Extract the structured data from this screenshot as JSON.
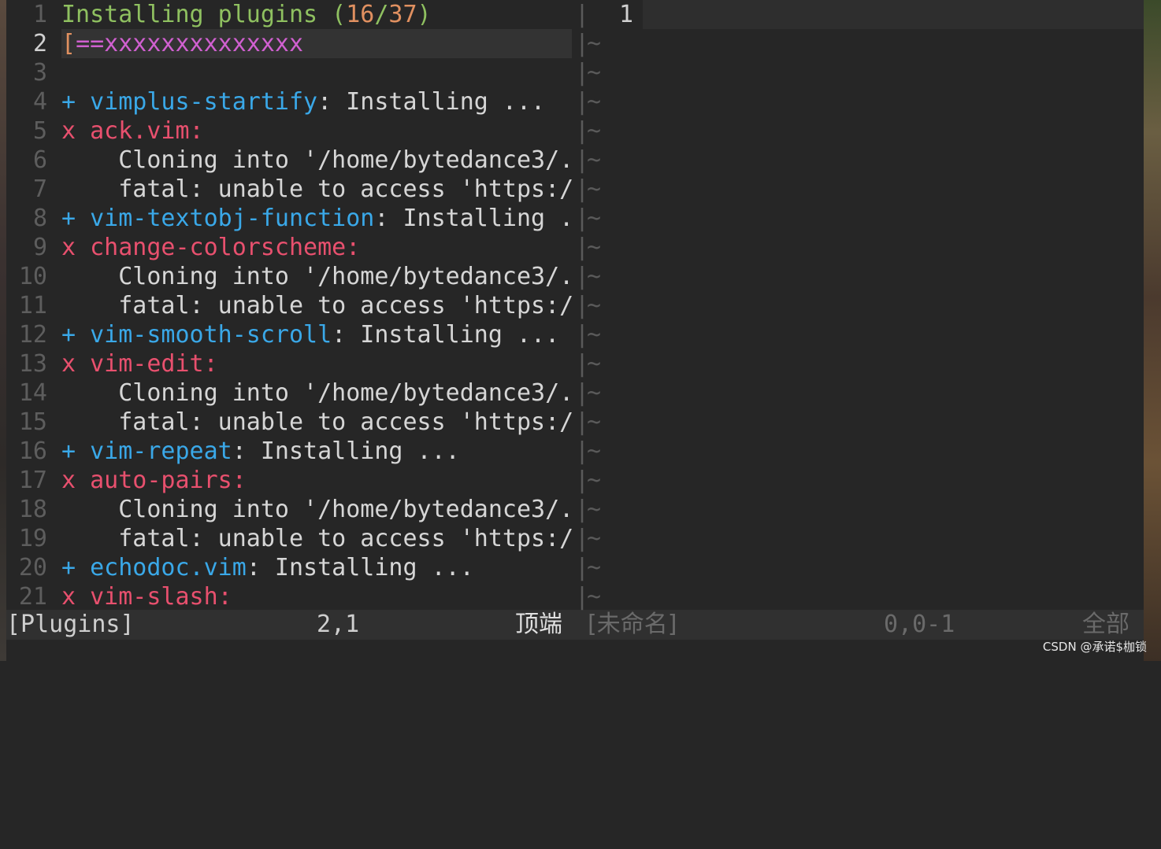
{
  "left_pane": {
    "lines": [
      {
        "num": "1",
        "segments": [
          {
            "text": "Installing plugins ",
            "color": "green"
          },
          {
            "text": "(",
            "color": "green"
          },
          {
            "text": "16",
            "color": "orange"
          },
          {
            "text": "/",
            "color": "green"
          },
          {
            "text": "37",
            "color": "orange"
          },
          {
            "text": ")",
            "color": "green"
          }
        ]
      },
      {
        "num": "2",
        "segments": [
          {
            "text": "[",
            "color": "orange"
          },
          {
            "text": "==xxxxxxxxxxxxxx",
            "color": "magenta"
          }
        ]
      },
      {
        "num": "3",
        "segments": []
      },
      {
        "num": "4",
        "segments": [
          {
            "text": "+ ",
            "color": "blue"
          },
          {
            "text": "vimplus-startify",
            "color": "blue"
          },
          {
            "text": ": Installing ...",
            "color": "white"
          }
        ]
      },
      {
        "num": "5",
        "segments": [
          {
            "text": "x ",
            "color": "red"
          },
          {
            "text": "ack.vim:",
            "color": "red"
          }
        ]
      },
      {
        "num": "6",
        "segments": [
          {
            "text": "    Cloning into '/home/bytedance3/.",
            "color": "white"
          }
        ]
      },
      {
        "num": "7",
        "segments": [
          {
            "text": "    fatal: unable to access 'https:/",
            "color": "white"
          }
        ]
      },
      {
        "num": "8",
        "segments": [
          {
            "text": "+ ",
            "color": "blue"
          },
          {
            "text": "vim-textobj-function",
            "color": "blue"
          },
          {
            "text": ": Installing .",
            "color": "white"
          }
        ]
      },
      {
        "num": "9",
        "segments": [
          {
            "text": "x ",
            "color": "red"
          },
          {
            "text": "change-colorscheme:",
            "color": "red"
          }
        ]
      },
      {
        "num": "10",
        "segments": [
          {
            "text": "    Cloning into '/home/bytedance3/.",
            "color": "white"
          }
        ]
      },
      {
        "num": "11",
        "segments": [
          {
            "text": "    fatal: unable to access 'https:/",
            "color": "white"
          }
        ]
      },
      {
        "num": "12",
        "segments": [
          {
            "text": "+ ",
            "color": "blue"
          },
          {
            "text": "vim-smooth-scroll",
            "color": "blue"
          },
          {
            "text": ": Installing ...",
            "color": "white"
          }
        ]
      },
      {
        "num": "13",
        "segments": [
          {
            "text": "x ",
            "color": "red"
          },
          {
            "text": "vim-edit:",
            "color": "red"
          }
        ]
      },
      {
        "num": "14",
        "segments": [
          {
            "text": "    Cloning into '/home/bytedance3/.",
            "color": "white"
          }
        ]
      },
      {
        "num": "15",
        "segments": [
          {
            "text": "    fatal: unable to access 'https:/",
            "color": "white"
          }
        ]
      },
      {
        "num": "16",
        "segments": [
          {
            "text": "+ ",
            "color": "blue"
          },
          {
            "text": "vim-repeat",
            "color": "blue"
          },
          {
            "text": ": Installing ...",
            "color": "white"
          }
        ]
      },
      {
        "num": "17",
        "segments": [
          {
            "text": "x ",
            "color": "red"
          },
          {
            "text": "auto-pairs:",
            "color": "red"
          }
        ]
      },
      {
        "num": "18",
        "segments": [
          {
            "text": "    Cloning into '/home/bytedance3/.",
            "color": "white"
          }
        ]
      },
      {
        "num": "19",
        "segments": [
          {
            "text": "    fatal: unable to access 'https:/",
            "color": "white"
          }
        ]
      },
      {
        "num": "20",
        "segments": [
          {
            "text": "+ ",
            "color": "blue"
          },
          {
            "text": "echodoc.vim",
            "color": "blue"
          },
          {
            "text": ": Installing ...",
            "color": "white"
          }
        ]
      },
      {
        "num": "21",
        "segments": [
          {
            "text": "x ",
            "color": "red"
          },
          {
            "text": "vim-slash:",
            "color": "red"
          }
        ]
      }
    ],
    "current_line": "2"
  },
  "divider": {
    "char": "|",
    "tilde": "~"
  },
  "right_pane": {
    "line_number": "1"
  },
  "statusbar": {
    "left_name": "[Plugins]",
    "left_pos": "2,1",
    "left_scroll": "顶端",
    "right_name": "[未命名]",
    "right_pos": "0,0-1",
    "right_scroll": "全部"
  },
  "watermark": "CSDN @承诺$枷锁",
  "colors": {
    "green": "#8fc060",
    "orange": "#e09060",
    "magenta": "#d060d0",
    "blue": "#3aa8e8",
    "red": "#e8506e",
    "white": "#d6d6d6"
  }
}
